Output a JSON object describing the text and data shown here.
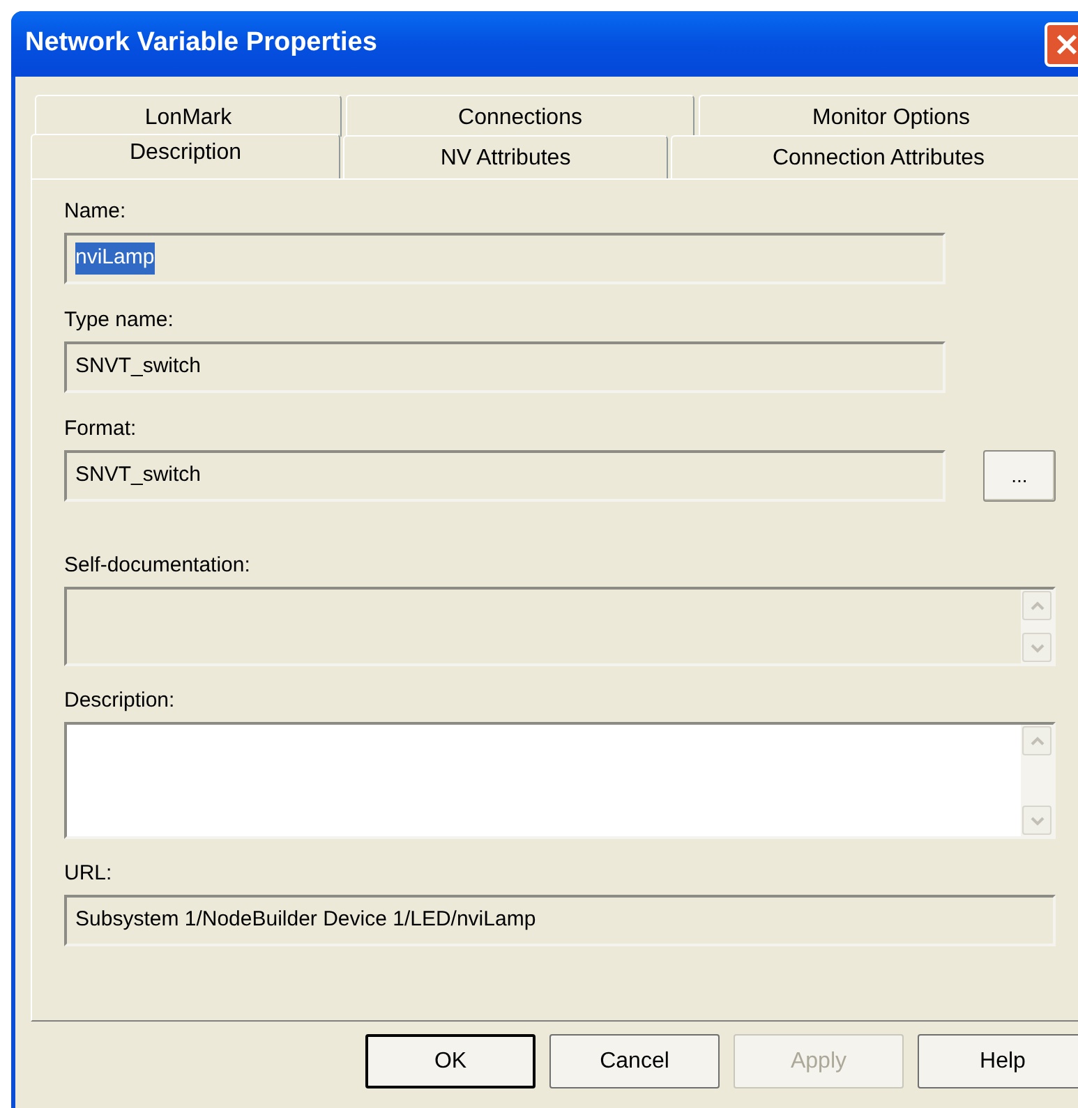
{
  "window": {
    "title": "Network Variable Properties"
  },
  "tab_rows": [
    {
      "tabs": [
        {
          "label": "LonMark",
          "selected": false
        },
        {
          "label": "Connections",
          "selected": false
        },
        {
          "label": "Monitor Options",
          "selected": false
        }
      ]
    },
    {
      "tabs": [
        {
          "label": "Description",
          "selected": true
        },
        {
          "label": "NV Attributes",
          "selected": false
        },
        {
          "label": "Connection Attributes",
          "selected": false
        }
      ]
    }
  ],
  "fields": [
    {
      "kind": "single",
      "label": "Name:",
      "value": "nviLamp",
      "value_selected": true,
      "read_only": true
    },
    {
      "kind": "single",
      "label": "Type name:",
      "value": "SNVT_switch",
      "value_selected": false,
      "read_only": true
    },
    {
      "kind": "browse",
      "label": "Format:",
      "value": "SNVT_switch",
      "value_selected": false,
      "read_only": true,
      "button": "..."
    },
    {
      "kind": "multiline",
      "label": "Self-documentation:",
      "read_only": true
    },
    {
      "kind": "multiline",
      "label": "Description:",
      "read_only": false
    },
    {
      "kind": "single",
      "label": "URL:",
      "value": "Subsystem 1/NodeBuilder Device 1/LED/nviLamp",
      "value_selected": false,
      "read_only": true
    }
  ],
  "buttons": [
    {
      "label": "OK",
      "disabled": false,
      "default": true
    },
    {
      "label": "Cancel",
      "disabled": false,
      "default": false
    },
    {
      "label": "Apply",
      "disabled": true,
      "default": false
    },
    {
      "label": "Help",
      "disabled": false,
      "default": false
    }
  ]
}
